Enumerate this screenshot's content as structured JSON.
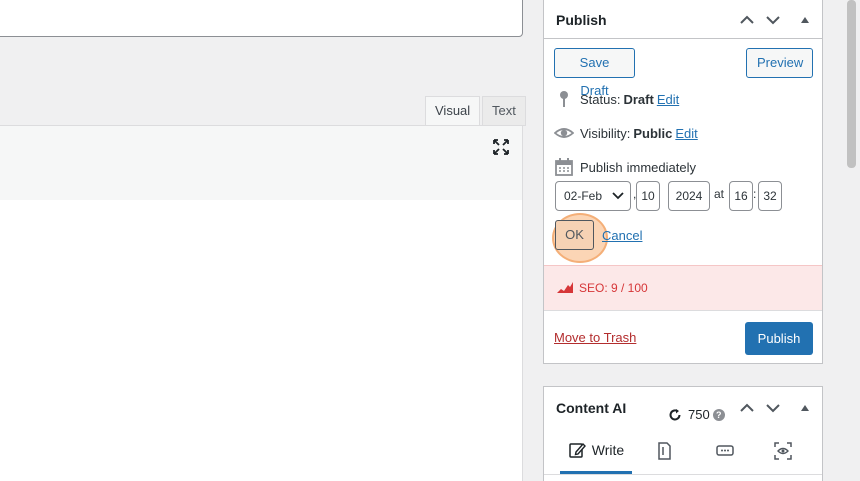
{
  "editor": {
    "tabs": [
      {
        "label": "Visual"
      },
      {
        "label": "Text"
      }
    ]
  },
  "publish": {
    "title": "Publish",
    "save_draft_label": "Save Draft",
    "preview_label": "Preview",
    "status_label": "Status:",
    "status_value": "Draft",
    "status_edit": "Edit",
    "visibility_label": "Visibility:",
    "visibility_value": "Public",
    "visibility_edit": "Edit",
    "publish_label": "Publish",
    "publish_value": "immediately",
    "date": {
      "month": "02-Feb",
      "day": "10",
      "year": "2024",
      "at": "at",
      "hour": "16",
      "minute": "32",
      "comma": ",",
      "colon": ":"
    },
    "ok_label": "OK",
    "cancel_label": "Cancel",
    "seo_text": "SEO: 9 / 100",
    "trash_label": "Move to Trash",
    "publish_button": "Publish"
  },
  "content_ai": {
    "title": "Content AI",
    "credits": "750",
    "help": "?",
    "tabs": [
      {
        "label": "Write",
        "icon": "pen-icon"
      },
      {
        "label": "",
        "icon": "document-icon"
      },
      {
        "label": "",
        "icon": "chat-icon"
      },
      {
        "label": "",
        "icon": "eye-scan-icon"
      }
    ]
  },
  "colors": {
    "accent": "#2271b1",
    "seo_bad": "#d63638",
    "highlight": "#f7b278"
  }
}
